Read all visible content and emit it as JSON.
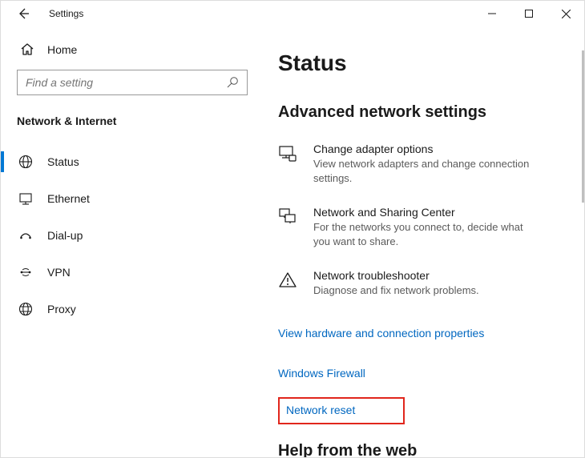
{
  "window": {
    "title": "Settings"
  },
  "sidebar": {
    "home": "Home",
    "search_placeholder": "Find a setting",
    "section": "Network & Internet",
    "items": [
      {
        "label": "Status",
        "icon": "globe"
      },
      {
        "label": "Ethernet",
        "icon": "ethernet"
      },
      {
        "label": "Dial-up",
        "icon": "dialup"
      },
      {
        "label": "VPN",
        "icon": "vpn"
      },
      {
        "label": "Proxy",
        "icon": "proxy"
      }
    ]
  },
  "main": {
    "heading": "Status",
    "section_title": "Advanced network settings",
    "options": [
      {
        "title": "Change adapter options",
        "desc": "View network adapters and change connection settings."
      },
      {
        "title": "Network and Sharing Center",
        "desc": "For the networks you connect to, decide what you want to share."
      },
      {
        "title": "Network troubleshooter",
        "desc": "Diagnose and fix network problems."
      }
    ],
    "links": [
      "View hardware and connection properties",
      "Windows Firewall",
      "Network reset"
    ],
    "help_heading": "Help from the web"
  }
}
